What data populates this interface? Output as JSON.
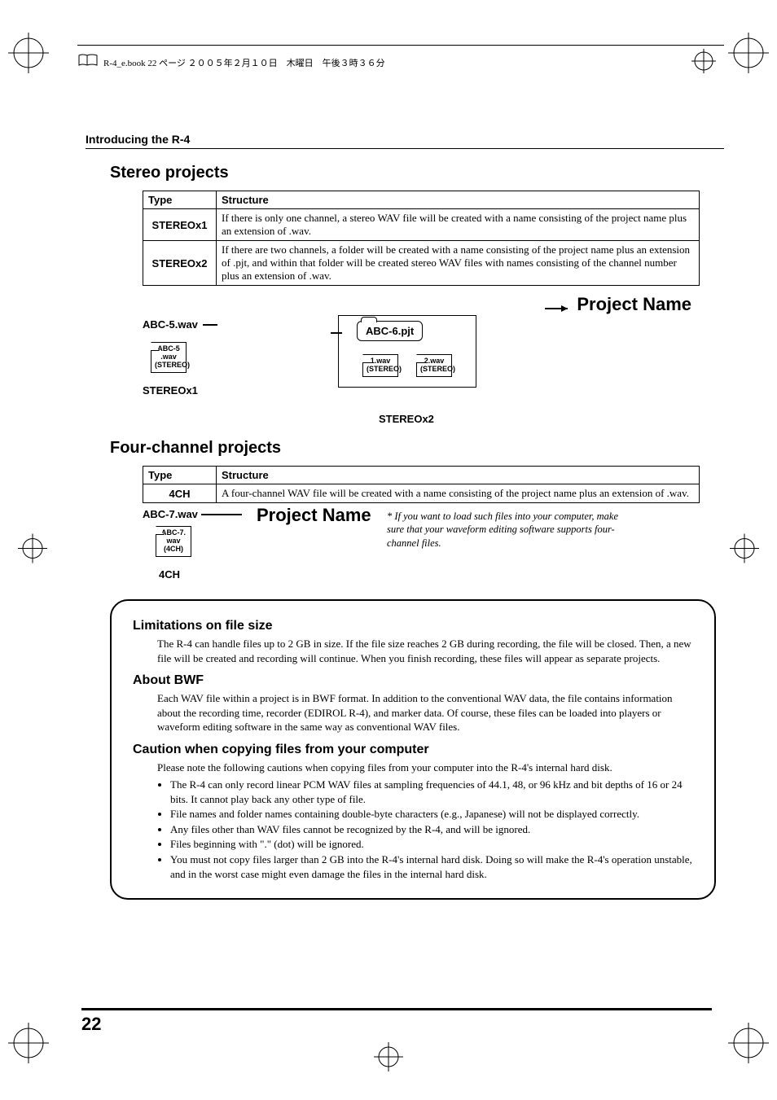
{
  "printHeader": "R-4_e.book 22 ページ ２００５年２月１０日　木曜日　午後３時３６分",
  "runningHeader": "Introducing the R-4",
  "section1": {
    "title": "Stereo projects",
    "tableHeaders": [
      "Type",
      "Structure"
    ],
    "rows": [
      {
        "type": "STEREOx1",
        "structure": "If there is only one channel, a stereo WAV file will be created with a name consisting of the project name plus an extension of .wav."
      },
      {
        "type": "STEREOx2",
        "structure": "If there are two channels, a folder will be created with a name consisting of the project name plus an extension of .pjt, and within that folder will be created stereo WAV files with names consisting of the channel number plus an extension of .wav."
      }
    ],
    "diagram": {
      "projectNameLabel": "Project Name",
      "stereox1Label": "ABC-5.wav",
      "stereox1File": "ABC-5 .wav (STEREO)",
      "stereox1Caption": "STEREOx1",
      "stereox2Folder": "ABC-6.pjt",
      "stereox2File1": "1.wav (STEREO)",
      "stereox2File2": "2.wav (STEREO)",
      "stereox2Caption": "STEREOx2"
    }
  },
  "section2": {
    "title": "Four-channel projects",
    "tableHeaders": [
      "Type",
      "Structure"
    ],
    "rows": [
      {
        "type": "4CH",
        "structure": "A four-channel WAV file will be created with a name consisting of the project name plus an extension of .wav."
      }
    ],
    "diagram": {
      "label": "ABC-7.wav",
      "file": "ABC-7. wav (4CH)",
      "caption": "4CH",
      "projectNameLabel": "Project Name",
      "note": "* If you want to load such files into your computer, make sure that your waveform editing software supports four-channel files."
    }
  },
  "notes": {
    "h1": "Limitations on file size",
    "p1": "The R-4 can handle files up to 2 GB in size. If the file size reaches 2 GB during recording, the file will be closed. Then, a new file will be created and recording will continue. When you finish recording, these files will appear as separate projects.",
    "h2": "About BWF",
    "p2": "Each WAV file within a project is in BWF format. In addition to the conventional WAV data, the file contains information about the recording time, recorder (EDIROL R-4), and marker data. Of course, these files can be loaded into players or waveform editing software in the same way as conventional WAV files.",
    "h3": "Caution when copying files from your computer",
    "p3": "Please note the following cautions when copying files from your computer into the R-4's internal hard disk.",
    "bullets": [
      "The R-4 can only record linear PCM WAV files at sampling frequencies of 44.1, 48, or 96 kHz and bit depths of 16 or 24 bits. It cannot play back any other type of file.",
      "File names and folder names containing double-byte characters (e.g., Japanese) will not be displayed correctly.",
      "Any files other than WAV files cannot be recognized by the R-4, and will be ignored.",
      "Files beginning with \".\" (dot) will be ignored.",
      "You must not copy files larger than 2 GB into the R-4's internal hard disk. Doing so will make the R-4's operation unstable, and in the worst case might even damage the files in the internal hard disk."
    ]
  },
  "pageNumber": "22"
}
